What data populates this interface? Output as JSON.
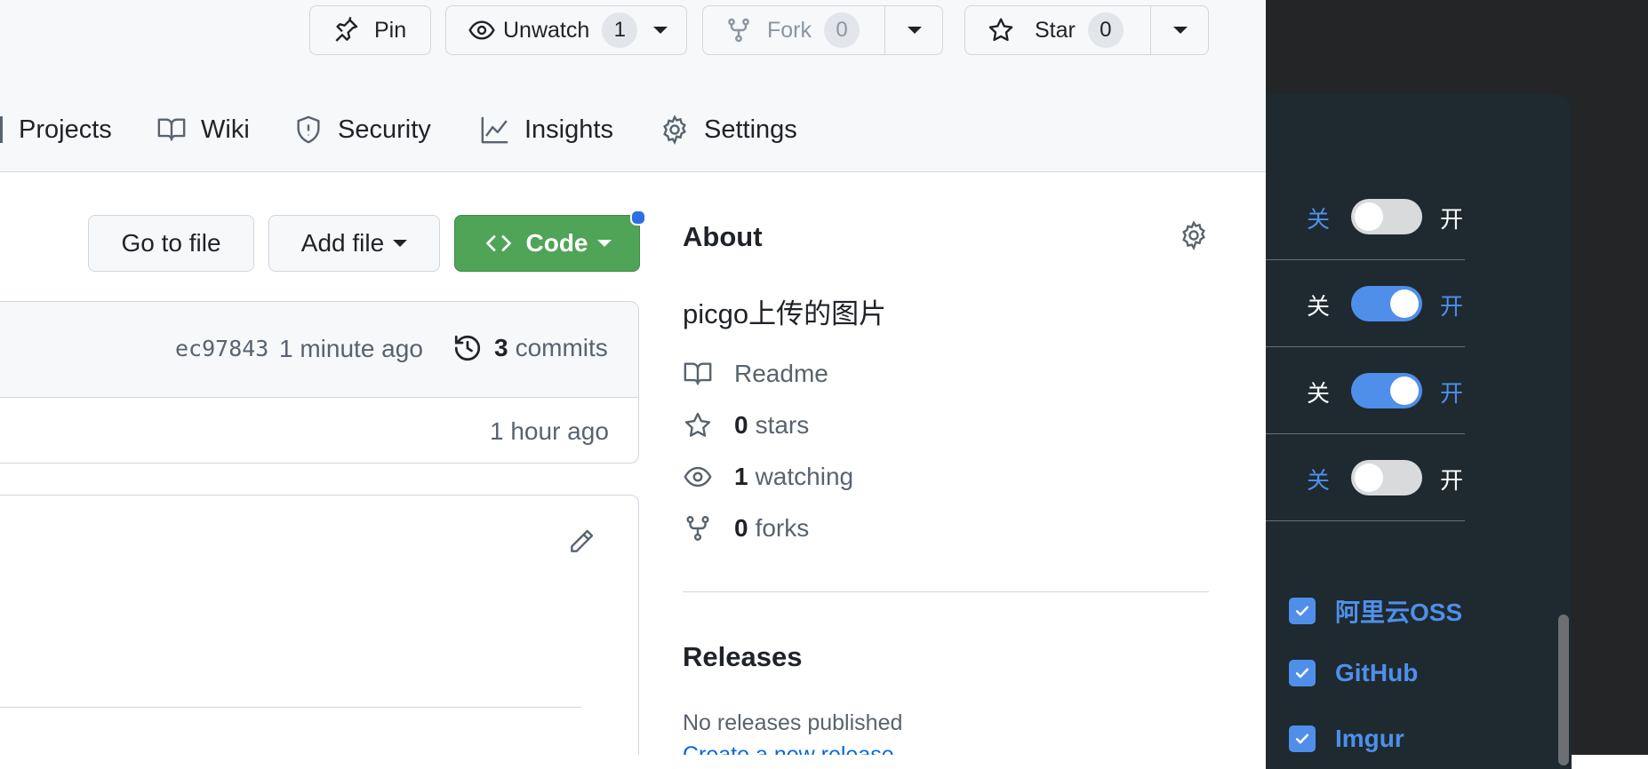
{
  "repo_actions": {
    "pin_label": "Pin",
    "unwatch_label": "Unwatch",
    "unwatch_count": "1",
    "fork_label": "Fork",
    "fork_count": "0",
    "star_label": "Star",
    "star_count": "0"
  },
  "nav": {
    "projects": "Projects",
    "wiki": "Wiki",
    "security": "Security",
    "insights": "Insights",
    "settings": "Settings"
  },
  "file_actions": {
    "go_to_file": "Go to file",
    "add_file": "Add file",
    "code": "Code"
  },
  "commit_bar": {
    "sha": "ec97843",
    "time": "1 minute ago",
    "commit_count": "3",
    "commits_label": "commits"
  },
  "file_row": {
    "time": "1 hour ago"
  },
  "about": {
    "heading": "About",
    "description": "picgo上传的图片",
    "readme": "Readme",
    "stars_count": "0",
    "stars_label": "stars",
    "watching_count": "1",
    "watching_label": "watching",
    "forks_count": "0",
    "forks_label": "forks"
  },
  "releases": {
    "heading": "Releases",
    "none": "No releases published",
    "create_link": "Create a new release"
  },
  "side_panel": {
    "toggles": [
      {
        "off_label": "关",
        "on_label": "开",
        "state": false
      },
      {
        "off_label": "关",
        "on_label": "开",
        "state": true
      },
      {
        "off_label": "关",
        "on_label": "开",
        "state": true
      },
      {
        "off_label": "关",
        "on_label": "开",
        "state": false
      }
    ],
    "checkboxes": [
      {
        "label": "阿里云OSS",
        "checked": true
      },
      {
        "label": "GitHub",
        "checked": true
      },
      {
        "label": "Imgur",
        "checked": true
      }
    ]
  },
  "colors": {
    "code_button_bg": "#4fa457",
    "toggle_on": "#4f8fea",
    "toggle_off": "#d9dadc",
    "accent_blue": "#4f8fea",
    "dark_panel": "#1e2a30"
  }
}
